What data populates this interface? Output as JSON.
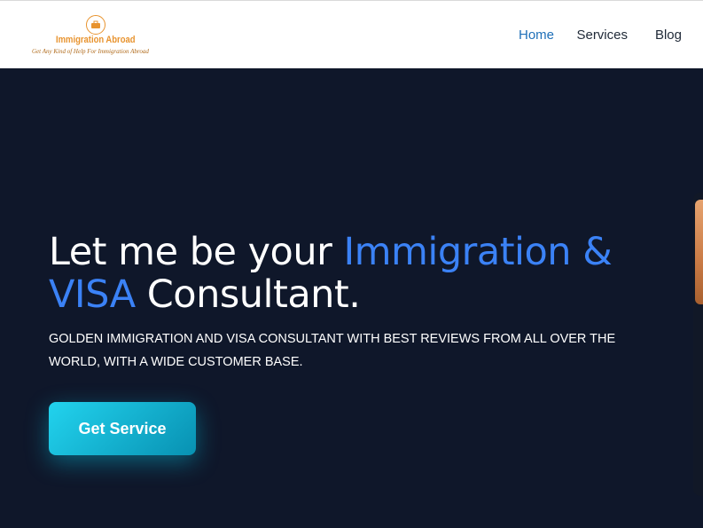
{
  "header": {
    "logo": {
      "name": "Immigration Abroad",
      "tagline": "Get Any Kind of Help For Immigration Abroad"
    },
    "nav": [
      {
        "label": "Home",
        "active": true
      },
      {
        "label": "Services",
        "active": false
      },
      {
        "label": "Blog",
        "active": false
      }
    ]
  },
  "hero": {
    "headline_part1": "Let me be your ",
    "headline_accent": "Immigration & VISA",
    "headline_part2": " Consultant.",
    "subtext": "GOLDEN IMMIGRATION AND VISA CONSULTANT WITH BEST REVIEWS FROM ALL OVER THE WORLD, WITH A WIDE CUSTOMER BASE.",
    "cta_label": "Get Service"
  },
  "colors": {
    "background": "#0f172a",
    "accent": "#3b82f6",
    "nav_active": "#1e6fb8",
    "logo": "#e8932e",
    "cta_gradient_start": "#22d3ee",
    "cta_gradient_end": "#0891b2"
  }
}
